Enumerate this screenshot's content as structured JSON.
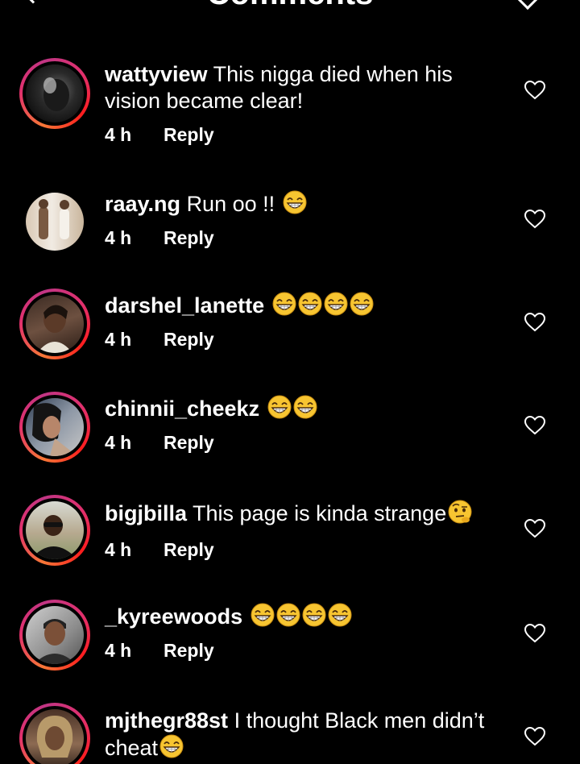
{
  "header": {
    "title": "Comments"
  },
  "comments": [
    {
      "username": "wattyview",
      "text": "This nigga died when his vision became clear!",
      "emoji_count": 0,
      "trailing_emoji": "",
      "time": "4 h",
      "reply": "Reply",
      "avatar": "dark-hooded-figure"
    },
    {
      "username": "raay.ng",
      "text": "Run oo !!",
      "emoji_count": 1,
      "trailing_emoji": "grin-emoji",
      "time": "4 h",
      "reply": "Reply",
      "avatar": "two-men-photo"
    },
    {
      "username": "darshel_lanette",
      "text": "",
      "emoji_count": 4,
      "trailing_emoji": "grin-emoji",
      "time": "4 h",
      "reply": "Reply",
      "avatar": "woman-selfie"
    },
    {
      "username": "chinnii_cheekz",
      "text": "",
      "emoji_count": 2,
      "trailing_emoji": "grin-emoji",
      "time": "4 h",
      "reply": "Reply",
      "avatar": "woman-car-selfie"
    },
    {
      "username": "bigjbilla",
      "text": "This page is kinda strange",
      "emoji_count": 1,
      "trailing_emoji": "raised-eyebrow-emoji",
      "time": "4 h",
      "reply": "Reply",
      "avatar": "man-outdoors"
    },
    {
      "username": "_kyreewoods",
      "text": "",
      "emoji_count": 4,
      "trailing_emoji": "grin-emoji",
      "time": "4 h",
      "reply": "Reply",
      "avatar": "young-man-portrait"
    },
    {
      "username": "mjthegr88st",
      "text": "I thought Black men didn’t cheat",
      "emoji_count": 1,
      "trailing_emoji": "grin-emoji",
      "time": "",
      "reply": "",
      "avatar": "woman-portrait"
    }
  ],
  "colors": {
    "background": "#000000",
    "text": "#ffffff",
    "story_ring_start": "#f77737",
    "story_ring_end": "#c13584",
    "emoji": "#f7c531"
  },
  "icons": {
    "back": "chevron-left-icon",
    "filter": "filter-icon",
    "like": "heart-outline-icon"
  }
}
